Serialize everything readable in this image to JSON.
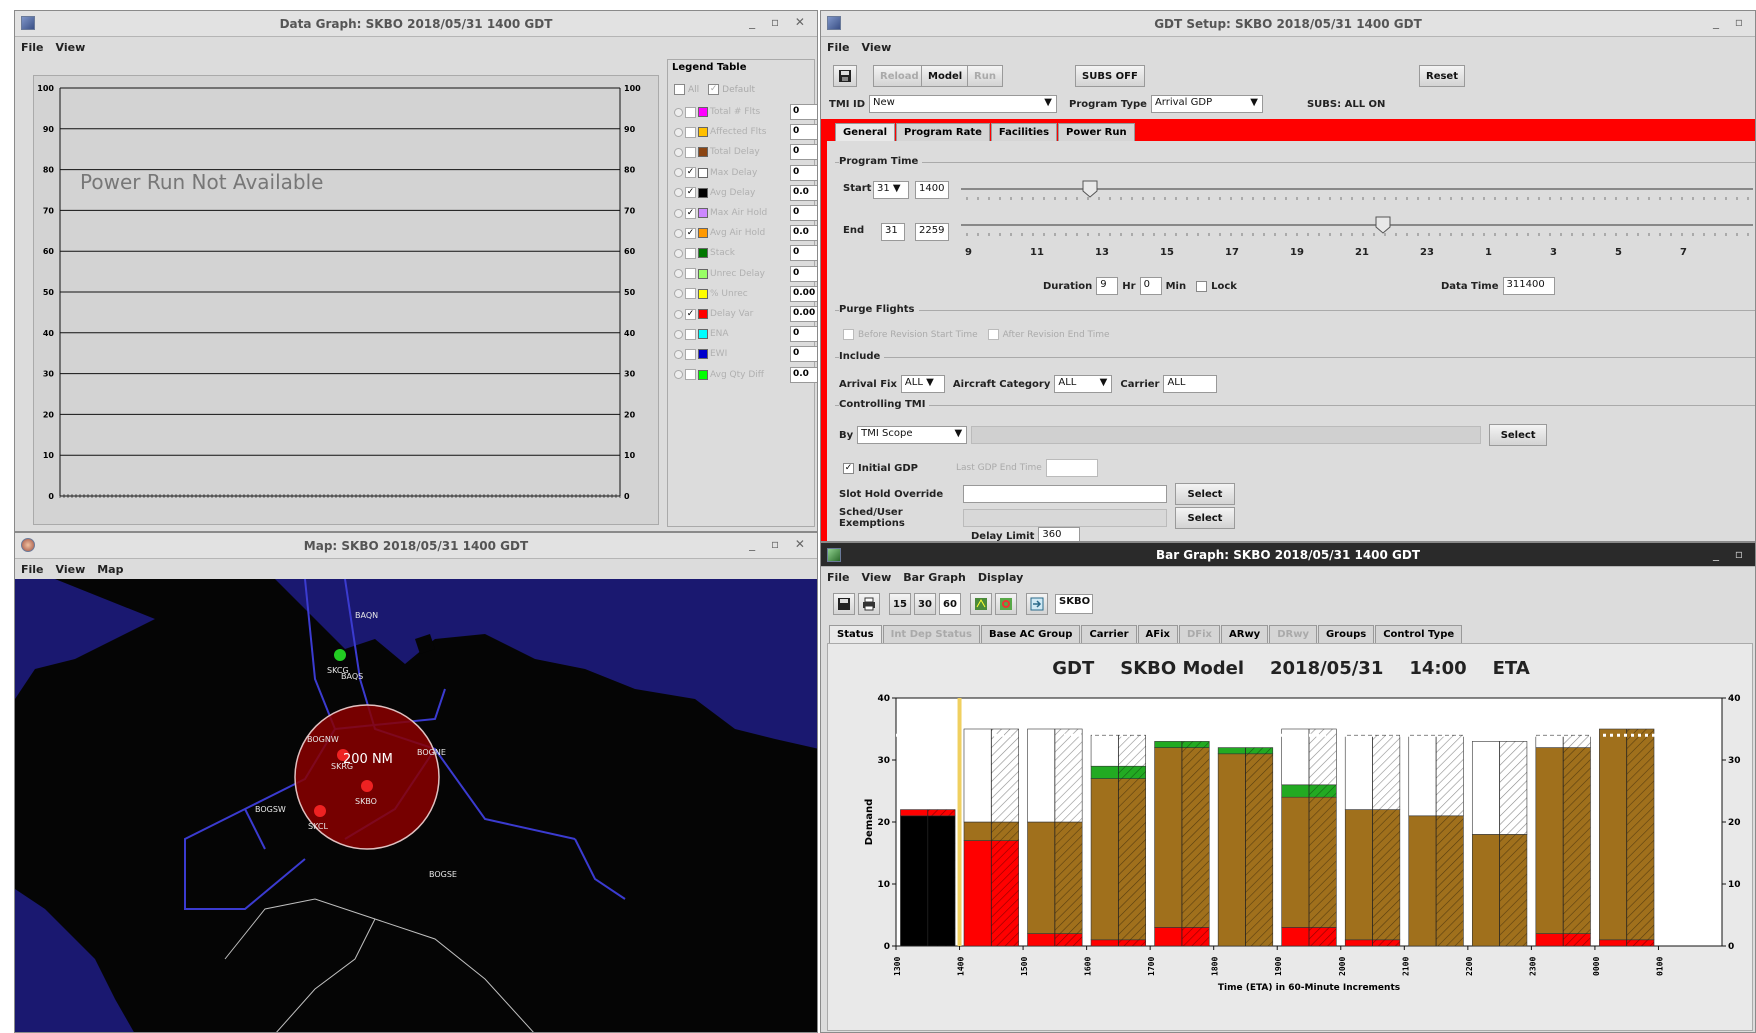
{
  "data_graph": {
    "title": "Data Graph: SKBO 2018/05/31 1400 GDT",
    "menu": [
      "File",
      "View"
    ],
    "notice": "Power Run Not Available",
    "y_ticks": [
      "100",
      "90",
      "80",
      "70",
      "60",
      "50",
      "40",
      "30",
      "20",
      "10",
      "0"
    ],
    "legend_title": "Legend Table",
    "legend_all": "All",
    "legend_default": "Default",
    "legend_rows": [
      {
        "name": "Total # Flts",
        "color": "#ff00ff",
        "value": "0",
        "checked": false
      },
      {
        "name": "Affected Flts",
        "color": "#ffc000",
        "value": "0",
        "checked": false
      },
      {
        "name": "Total Delay",
        "color": "#8b4513",
        "value": "0",
        "checked": false
      },
      {
        "name": "Max Delay",
        "color": "#ffffff",
        "value": "0",
        "checked": true
      },
      {
        "name": "Avg Delay",
        "color": "#000000",
        "value": "0.0",
        "checked": true
      },
      {
        "name": "Max Air Hold",
        "color": "#cc88ff",
        "value": "0",
        "checked": true
      },
      {
        "name": "Avg Air Hold",
        "color": "#ff9900",
        "value": "0.0",
        "checked": true
      },
      {
        "name": "Stack",
        "color": "#007700",
        "value": "0",
        "checked": false
      },
      {
        "name": "Unrec Delay",
        "color": "#99ff66",
        "value": "0",
        "checked": false
      },
      {
        "name": "% Unrec",
        "color": "#ffff00",
        "value": "0.00",
        "checked": false
      },
      {
        "name": "Delay Var",
        "color": "#ff0000",
        "value": "0.00",
        "checked": true
      },
      {
        "name": "ENA",
        "color": "#00ffff",
        "value": "0",
        "checked": false
      },
      {
        "name": "EWI",
        "color": "#0000cc",
        "value": "0",
        "checked": false
      },
      {
        "name": "Avg Qty Diff",
        "color": "#00ff00",
        "value": "0.0",
        "checked": false
      }
    ]
  },
  "map": {
    "title": "Map: SKBO 2018/05/31 1400 GDT",
    "menu": [
      "File",
      "View",
      "Map"
    ],
    "radius_label": "200 NM",
    "labels": [
      "BAQN",
      "SKCG",
      "BAQS",
      "BOGNW",
      "SKRG",
      "BOGNE",
      "SKBO",
      "BOGSW",
      "SKCL",
      "BOGSE"
    ]
  },
  "setup": {
    "title": "GDT Setup: SKBO 2018/05/31 1400 GDT",
    "menu": [
      "File",
      "View"
    ],
    "toolbar": {
      "reload": "Reload",
      "model": "Model",
      "run": "Run",
      "subs_off": "SUBS OFF",
      "reset": "Reset"
    },
    "tmi_id_label": "TMI ID",
    "tmi_id_value": "New",
    "program_type_label": "Program Type",
    "program_type_value": "Arrival GDP",
    "subs_status": "SUBS: ALL ON",
    "tabs": [
      "General",
      "Program Rate",
      "Facilities",
      "Power Run"
    ],
    "program_time": "Program Time",
    "start_label": "Start",
    "start_day": "31",
    "start_time": "1400",
    "end_label": "End",
    "end_day": "31",
    "end_time": "2259",
    "hour_ticks": [
      "9",
      "11",
      "13",
      "15",
      "17",
      "19",
      "21",
      "23",
      "1",
      "3",
      "5",
      "7"
    ],
    "duration_label": "Duration",
    "duration_hr": "9",
    "hr_label": "Hr",
    "duration_min": "0",
    "min_label": "Min",
    "lock_label": "Lock",
    "data_time_label": "Data Time",
    "data_time_value": "311400",
    "purge_title": "Purge Flights",
    "purge_before": "Before Revision Start Time",
    "purge_after": "After Revision End Time",
    "include_title": "Include",
    "arrival_fix_label": "Arrival Fix",
    "arrival_fix_value": "ALL",
    "aircraft_cat_label": "Aircraft Category",
    "aircraft_cat_value": "ALL",
    "carrier_label": "Carrier",
    "carrier_value": "ALL",
    "controlling_title": "Controlling TMI",
    "by_label": "By",
    "by_value": "TMI Scope",
    "select": "Select",
    "initial_gdp": "Initial GDP",
    "last_gdp_end": "Last GDP End Time",
    "slot_hold": "Slot Hold Override",
    "sched_user": "Sched/User Exemptions",
    "delay_limit_label": "Delay Limit",
    "delay_limit_value": "360"
  },
  "bar_graph": {
    "title": "Bar Graph: SKBO 2018/05/31 1400 GDT",
    "menu": [
      "File",
      "View",
      "Bar Graph",
      "Display"
    ],
    "bins": [
      "15",
      "30",
      "60"
    ],
    "airport": "SKBO",
    "tabs": [
      "Status",
      "Int Dep Status",
      "Base AC Group",
      "Carrier",
      "AFix",
      "DFix",
      "ARwy",
      "DRwy",
      "Groups",
      "Control Type"
    ],
    "header": {
      "a": "GDT",
      "b": "SKBO Model",
      "c": "2018/05/31",
      "d": "14:00",
      "e": "ETA"
    }
  },
  "chart_data": {
    "type": "bar",
    "title": "GDT SKBO Model 2018/05/31 14:00 ETA",
    "xlabel": "Time (ETA) in 60-Minute Increments",
    "ylabel": "Demand",
    "ylim": [
      0,
      40
    ],
    "y_ticks": [
      0,
      10,
      20,
      30,
      40
    ],
    "categories": [
      "1300",
      "1400",
      "1500",
      "1600",
      "1700",
      "1800",
      "1900",
      "2000",
      "2100",
      "2200",
      "2300",
      "0000",
      "0100"
    ],
    "capacity": 34,
    "series": [
      {
        "name": "Black",
        "color": "#000000",
        "values": [
          21,
          0,
          0,
          0,
          0,
          0,
          0,
          0,
          0,
          0,
          0,
          0,
          0
        ]
      },
      {
        "name": "Red",
        "color": "#ff0000",
        "values": [
          1,
          17,
          2,
          1,
          3,
          0,
          3,
          1,
          0,
          0,
          2,
          1,
          0
        ]
      },
      {
        "name": "Brown",
        "color": "#a0701c",
        "values": [
          0,
          3,
          18,
          26,
          29,
          31,
          21,
          21,
          21,
          18,
          30,
          34,
          0
        ]
      },
      {
        "name": "Green",
        "color": "#22aa22",
        "values": [
          0,
          0,
          0,
          2,
          1,
          1,
          2,
          0,
          0,
          0,
          0,
          0,
          0
        ]
      },
      {
        "name": "White",
        "color": "#ffffff",
        "values": [
          0,
          15,
          15,
          5,
          0,
          0,
          9,
          12,
          13,
          15,
          2,
          0,
          0
        ]
      }
    ]
  }
}
